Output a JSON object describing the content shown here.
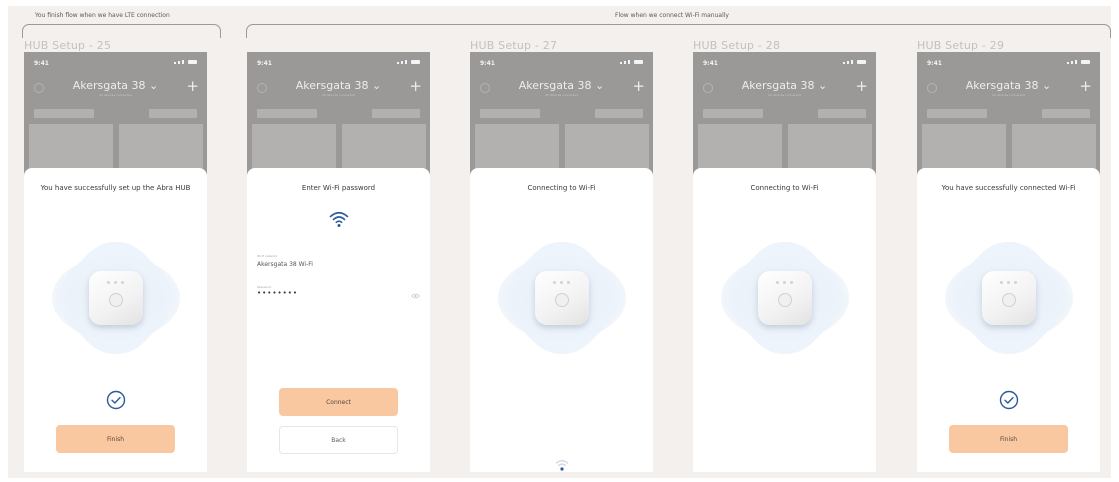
{
  "captions": {
    "lte": "You finish flow when we have LTE connection",
    "manual": "Flow when we connect Wi-Fi manually"
  },
  "screens": [
    {
      "frame_title": "HUB Setup - 25",
      "time": "9:41",
      "header_title": "Akersgata 38",
      "header_sub": "All devices connected",
      "sheet_title": "You have successfully set up the Abra HUB",
      "primary_button": "Finish"
    },
    {
      "frame_title": "",
      "time": "9:41",
      "header_title": "Akersgata 38",
      "header_sub": "All devices connected",
      "sheet_title": "Enter Wi-Fi password",
      "network_label": "Wi-Fi network",
      "network_value": "Akersgata 38 Wi-Fi",
      "password_label": "Password",
      "password_value": "••••••••",
      "primary_button": "Connect",
      "secondary_button": "Back"
    },
    {
      "frame_title": "HUB Setup - 27",
      "time": "9:41",
      "header_title": "Akersgata 38",
      "header_sub": "All devices connected",
      "sheet_title": "Connecting to Wi-Fi"
    },
    {
      "frame_title": "HUB Setup - 28",
      "time": "9:41",
      "header_title": "Akersgata 38",
      "header_sub": "All devices connected",
      "sheet_title": "Connecting to Wi-Fi"
    },
    {
      "frame_title": "HUB Setup - 29",
      "time": "9:41",
      "header_title": "Akersgata 38",
      "header_sub": "All devices connected",
      "sheet_title": "You have successfully connected Wi-Fi",
      "primary_button": "Finish"
    }
  ],
  "colors": {
    "canvas": "#f3f0ee",
    "primary_button": "#f9c8a1",
    "accent_blue": "#2c5a9a"
  }
}
